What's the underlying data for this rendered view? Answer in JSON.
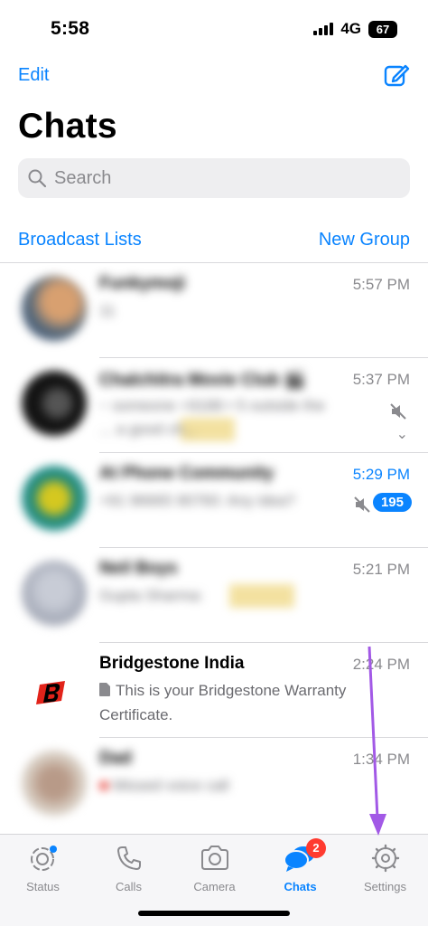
{
  "status_bar": {
    "time": "5:58",
    "network": "4G",
    "battery": "67"
  },
  "header": {
    "edit_label": "Edit",
    "title": "Chats"
  },
  "search": {
    "placeholder": "Search"
  },
  "actions": {
    "broadcast_label": "Broadcast Lists",
    "new_group_label": "New Group"
  },
  "chats": [
    {
      "name": "Funkymoji",
      "time": "5:57 PM",
      "preview": "11"
    },
    {
      "name": "Chalchitra Movie Club 🎬",
      "time": "5:37 PM",
      "preview": "~ someone +9188 • 5 outside the",
      "preview2": "... a good ch..."
    },
    {
      "name": "At Phone Community",
      "time": "5:29 PM",
      "preview": "+91 96665 90760: Any idea?",
      "badge": "195"
    },
    {
      "name": "Neil Boys",
      "time": "5:21 PM",
      "preview": "Gupta Sharma:"
    },
    {
      "name": "Bridgestone India",
      "time": "2:24 PM",
      "preview": "This is your Bridgestone Warranty",
      "preview2": "Certificate."
    },
    {
      "name": "Dad",
      "time": "1:34 PM",
      "preview": "Missed voice call"
    }
  ],
  "tabs": [
    {
      "label": "Status"
    },
    {
      "label": "Calls"
    },
    {
      "label": "Camera"
    },
    {
      "label": "Chats",
      "badge": "2"
    },
    {
      "label": "Settings"
    }
  ],
  "colors": {
    "accent": "#0a84ff",
    "badge_red": "#ff3b30",
    "annotation": "#a259e6"
  }
}
